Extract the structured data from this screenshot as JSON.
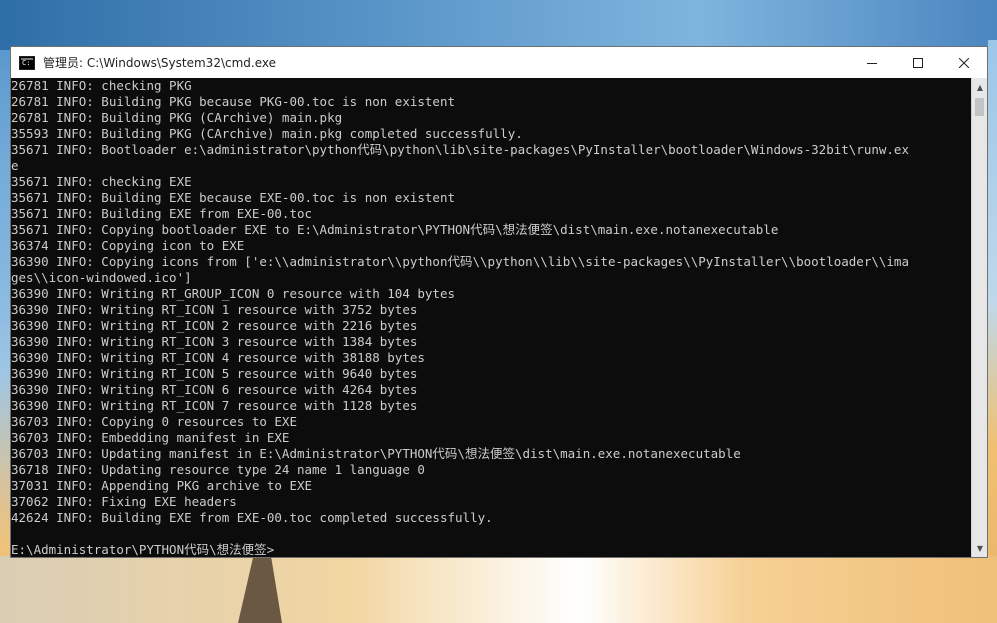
{
  "window": {
    "title": "管理员: C:\\Windows\\System32\\cmd.exe"
  },
  "controls": {
    "minimize_icon": "minimize-icon",
    "maximize_icon": "maximize-icon",
    "close_icon": "close-icon"
  },
  "console": {
    "lines": [
      "26781 INFO: checking PKG",
      "26781 INFO: Building PKG because PKG-00.toc is non existent",
      "26781 INFO: Building PKG (CArchive) main.pkg",
      "35593 INFO: Building PKG (CArchive) main.pkg completed successfully.",
      "35671 INFO: Bootloader e:\\administrator\\python代码\\python\\lib\\site-packages\\PyInstaller\\bootloader\\Windows-32bit\\runw.ex",
      "e",
      "35671 INFO: checking EXE",
      "35671 INFO: Building EXE because EXE-00.toc is non existent",
      "35671 INFO: Building EXE from EXE-00.toc",
      "35671 INFO: Copying bootloader EXE to E:\\Administrator\\PYTHON代码\\想法便签\\dist\\main.exe.notanexecutable",
      "36374 INFO: Copying icon to EXE",
      "36390 INFO: Copying icons from ['e:\\\\administrator\\\\python代码\\\\python\\\\lib\\\\site-packages\\\\PyInstaller\\\\bootloader\\\\ima",
      "ges\\\\icon-windowed.ico']",
      "36390 INFO: Writing RT_GROUP_ICON 0 resource with 104 bytes",
      "36390 INFO: Writing RT_ICON 1 resource with 3752 bytes",
      "36390 INFO: Writing RT_ICON 2 resource with 2216 bytes",
      "36390 INFO: Writing RT_ICON 3 resource with 1384 bytes",
      "36390 INFO: Writing RT_ICON 4 resource with 38188 bytes",
      "36390 INFO: Writing RT_ICON 5 resource with 9640 bytes",
      "36390 INFO: Writing RT_ICON 6 resource with 4264 bytes",
      "36390 INFO: Writing RT_ICON 7 resource with 1128 bytes",
      "36703 INFO: Copying 0 resources to EXE",
      "36703 INFO: Embedding manifest in EXE",
      "36703 INFO: Updating manifest in E:\\Administrator\\PYTHON代码\\想法便签\\dist\\main.exe.notanexecutable",
      "36718 INFO: Updating resource type 24 name 1 language 0",
      "37031 INFO: Appending PKG archive to EXE",
      "37062 INFO: Fixing EXE headers",
      "42624 INFO: Building EXE from EXE-00.toc completed successfully.",
      "",
      "E:\\Administrator\\PYTHON代码\\想法便签>"
    ]
  },
  "scrollbar": {
    "up_arrow": "▲",
    "down_arrow": "▼"
  }
}
